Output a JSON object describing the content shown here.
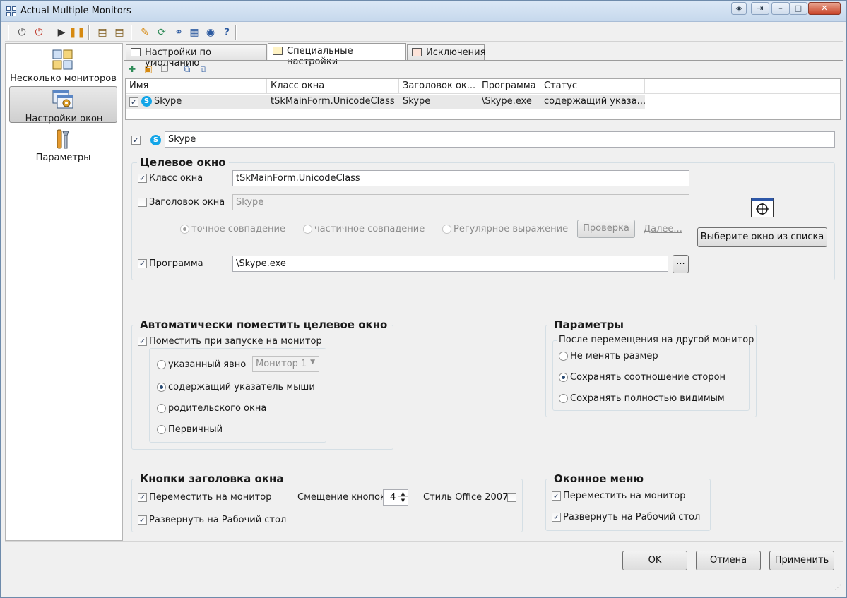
{
  "window": {
    "title": "Actual Multiple Monitors"
  },
  "toolbar": {
    "icons": [
      "power-icon",
      "stop-icon",
      "play-icon",
      "pause-icon",
      "export-icon",
      "import-icon",
      "help-edit-icon",
      "update-icon",
      "link-icon",
      "monitor-icon",
      "web-icon",
      "help-icon"
    ]
  },
  "leftnav": {
    "items": [
      {
        "label": "Несколько мониторов",
        "icon": "monitors-icon"
      },
      {
        "label": "Настройки окон",
        "icon": "window-settings-icon"
      },
      {
        "label": "Параметры",
        "icon": "tools-icon"
      }
    ]
  },
  "tabs": [
    {
      "label": "Настройки по умолчанию"
    },
    {
      "label": "Специальные настройки"
    },
    {
      "label": "Исключения"
    }
  ],
  "list": {
    "columns": [
      "Имя",
      "Класс окна",
      "Заголовок ок...",
      "Программа",
      "Статус"
    ],
    "rows": [
      {
        "name": "Skype",
        "class": "tSkMainForm.UnicodeClass",
        "caption": "Skype",
        "program": "\\Skype.exe",
        "status": "содержащий указа..."
      }
    ]
  },
  "rule": {
    "name": "Skype"
  },
  "target": {
    "title": "Целевое окно",
    "class_label": "Класс окна",
    "class_value": "tSkMainForm.UnicodeClass",
    "caption_label": "Заголовок окна",
    "caption_value": "Skype",
    "match_exact": "точное совпадение",
    "match_partial": "частичное совпадение",
    "match_regex": "Регулярное выражение",
    "check_button": "Проверка",
    "more_link": "Далее...",
    "program_label": "Программа",
    "program_value": "\\Skype.exe",
    "browse_button": "...",
    "select_button": "Выберите окно из списка"
  },
  "auto": {
    "title": "Автоматически поместить целевое окно",
    "place_label": "Поместить при запуске на монитор",
    "opt_explicit": "указанный явно",
    "monitor_select": "Монитор 1",
    "opt_mouse": "содержащий указатель мыши",
    "opt_parent": "родительского окна",
    "opt_primary": "Первичный"
  },
  "params": {
    "title": "Параметры",
    "subtitle": "После перемещения на другой монитор",
    "opt_keep": "Не менять размер",
    "opt_aspect": "Сохранять соотношение сторон",
    "opt_visible": "Сохранять полностью видимым"
  },
  "titlebuttons": {
    "title": "Кнопки заголовка окна",
    "move_label": "Переместить на монитор",
    "offset_label": "Смещение кнопок",
    "offset_value": "4",
    "office_label": "Стиль Office 2007",
    "maximize_label": "Развернуть на Рабочий стол"
  },
  "winmenu": {
    "title": "Оконное меню",
    "move_label": "Переместить на монитор",
    "maximize_label": "Развернуть на Рабочий стол"
  },
  "buttons": {
    "ok": "OK",
    "cancel": "Отмена",
    "apply": "Применить"
  },
  "colors": {
    "accent": "#284a73",
    "skype": "#12a5e8"
  }
}
